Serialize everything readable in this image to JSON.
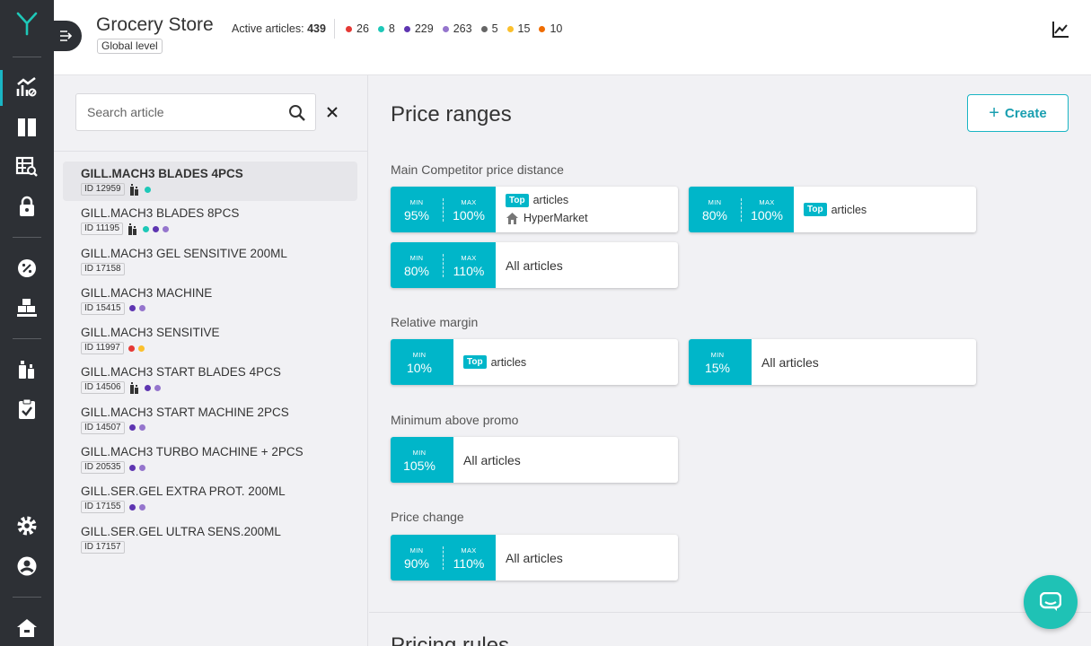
{
  "header": {
    "store_title": "Grocery Store",
    "level_badge": "Global level",
    "active_label": "Active articles:",
    "active_count": "439",
    "counts": [
      {
        "value": "26",
        "color": "#e53935"
      },
      {
        "value": "8",
        "color": "#1ec8b8"
      },
      {
        "value": "229",
        "color": "#5e35b1"
      },
      {
        "value": "263",
        "color": "#9575cd"
      },
      {
        "value": "5",
        "color": "#666666"
      },
      {
        "value": "15",
        "color": "#fbc02d"
      },
      {
        "value": "10",
        "color": "#ef6c00"
      }
    ]
  },
  "search": {
    "placeholder": "Search article"
  },
  "articles": [
    {
      "name": "GILL.MACH3 BLADES 4PCS",
      "id": "ID 12959"
    },
    {
      "name": "GILL.MACH3 BLADES 8PCS",
      "id": "ID 11195"
    },
    {
      "name": "GILL.MACH3 GEL SENSITIVE 200ML",
      "id": "ID 17158"
    },
    {
      "name": "GILL.MACH3 MACHINE",
      "id": "ID 15415"
    },
    {
      "name": "GILL.MACH3 SENSITIVE",
      "id": "ID 11997"
    },
    {
      "name": "GILL.MACH3 START BLADES 4PCS",
      "id": "ID 14506"
    },
    {
      "name": "GILL.MACH3 START MACHINE 2PCS",
      "id": "ID 14507"
    },
    {
      "name": "GILL.MACH3 TURBO MACHINE + 2PCS",
      "id": "ID 20535"
    },
    {
      "name": "GILL.SER.GEL EXTRA PROT. 200ML",
      "id": "ID 17155"
    },
    {
      "name": "GILL.SER.GEL ULTRA SENS.200ML",
      "id": "ID 17157"
    }
  ],
  "main": {
    "title": "Price ranges",
    "create_label": "Create",
    "sections": {
      "competitor": "Main Competitor price distance",
      "margin": "Relative margin",
      "promo": "Minimum above promo",
      "change": "Price change"
    },
    "labels": {
      "min": "MIN",
      "max": "MAX",
      "top": "Top",
      "articles": "articles",
      "all_articles": "All articles"
    },
    "cards": {
      "c1": {
        "min": "95%",
        "max": "100%",
        "store": "HyperMarket"
      },
      "c2": {
        "min": "80%",
        "max": "100%"
      },
      "c3": {
        "min": "80%",
        "max": "110%"
      },
      "m1": {
        "min": "10%"
      },
      "m2": {
        "min": "15%"
      },
      "p1": {
        "min": "105%"
      },
      "ch1": {
        "min": "90%",
        "max": "110%"
      }
    },
    "next_heading": "Pricing rules"
  },
  "colors": {
    "accent": "#00b6c9",
    "sidebar": "#2d3035",
    "chat": "#1fc2b5"
  }
}
